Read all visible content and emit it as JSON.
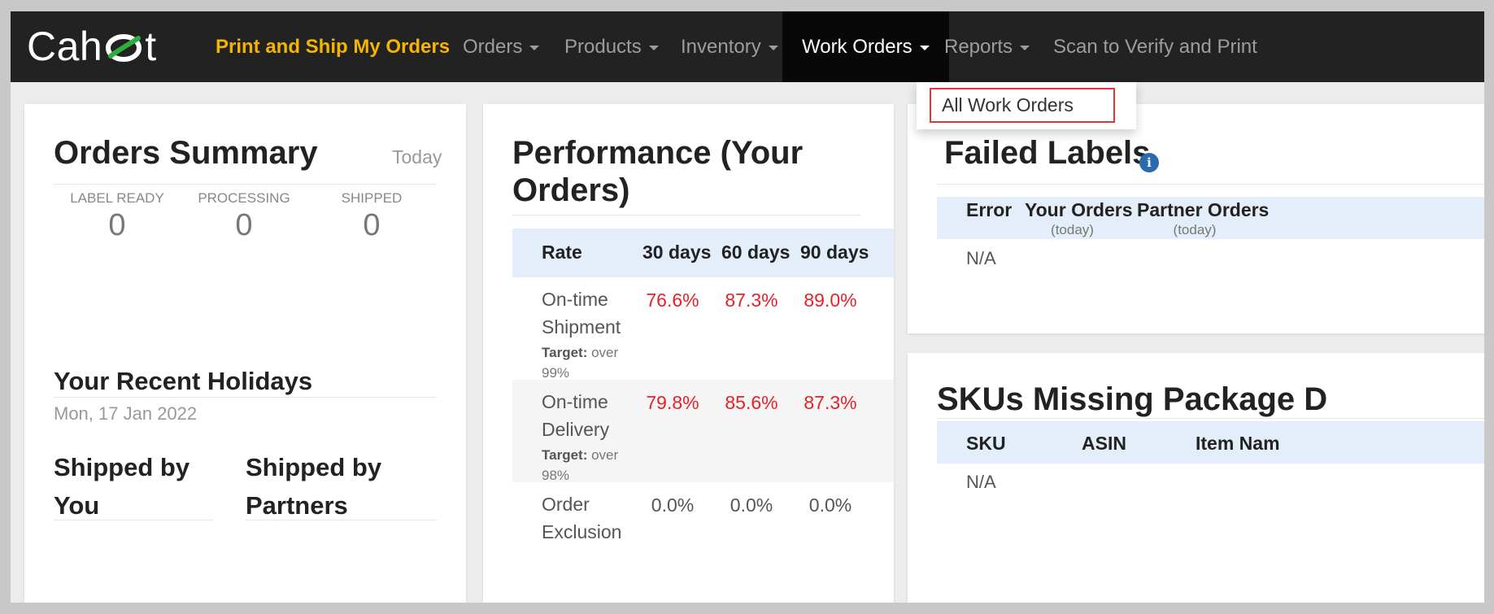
{
  "brand": {
    "name_start": "Cah",
    "name_end": "t"
  },
  "nav": {
    "print_ship": "Print and Ship My Orders",
    "orders": "Orders",
    "products": "Products",
    "inventory": "Inventory",
    "work_orders": "Work Orders",
    "reports": "Reports",
    "scan_verify": "Scan to Verify and Print"
  },
  "dropdown": {
    "all_work_orders": "All Work Orders"
  },
  "orders_summary": {
    "title": "Orders Summary",
    "period": "Today",
    "stats": [
      {
        "label": "LABEL READY",
        "value": "0"
      },
      {
        "label": "PROCESSING",
        "value": "0"
      },
      {
        "label": "SHIPPED",
        "value": "0"
      }
    ],
    "holidays_title": "Your Recent Holidays",
    "holiday_date": "Mon, 17 Jan 2022",
    "shipped_by_you": "Shipped by You",
    "shipped_by_partners": "Shipped by Partners"
  },
  "performance": {
    "title": "Performance (Your Orders)",
    "headers": [
      "Rate",
      "30 days",
      "60 days",
      "90 days"
    ],
    "rows": [
      {
        "name": "On-time Shipment",
        "target_label": "Target:",
        "target_value": "over 99%",
        "values": [
          "76.6%",
          "87.3%",
          "89.0%"
        ]
      },
      {
        "name": "On-time Delivery",
        "target_label": "Target:",
        "target_value": "over 98%",
        "values": [
          "79.8%",
          "85.6%",
          "87.3%"
        ]
      },
      {
        "name": "Order Exclusion",
        "values": [
          "0.0%",
          "0.0%",
          "0.0%"
        ]
      }
    ]
  },
  "failed_labels": {
    "title": "Failed Labels",
    "headers": [
      "Error",
      "Your Orders",
      "Partner Orders"
    ],
    "subheaders": [
      "(today)",
      "(today)"
    ],
    "empty": "N/A"
  },
  "skus_missing": {
    "title": "SKUs Missing Package D",
    "headers": [
      "SKU",
      "ASIN",
      "Item Nam"
    ],
    "empty": "N/A"
  },
  "colors": {
    "nav_bg": "#222222",
    "nav_highlight": "#f5b400",
    "bad_value": "#e8202a",
    "table_head_bg": "#e3eefa",
    "dropdown_border": "#e0353b"
  }
}
